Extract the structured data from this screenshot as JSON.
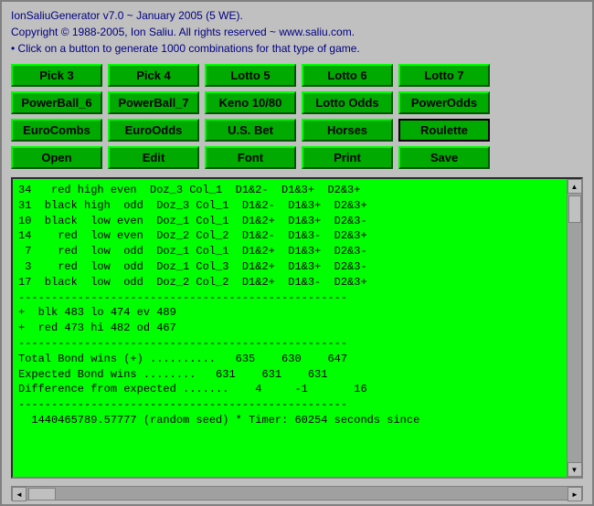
{
  "header": {
    "line1": "IonSaliuGenerator v7.0 ~ January 2005 (5 WE).",
    "line2": "Copyright © 1988-2005, Ion Saliu. All rights reserved ~ www.saliu.com.",
    "line3": "• Click on a button to generate 1000 combinations for that type of game."
  },
  "buttons": {
    "row1": [
      "Pick 3",
      "Pick 4",
      "Lotto 5",
      "Lotto 6",
      "Lotto 7"
    ],
    "row2": [
      "PowerBall_6",
      "PowerBall_7",
      "Keno 10/80",
      "Lotto Odds",
      "PowerOdds"
    ],
    "row3": [
      "EuroCombs",
      "EuroOdds",
      "U.S. Bet",
      "Horses",
      "Roulette"
    ],
    "row4": [
      "Open",
      "Edit",
      "Font",
      "Print",
      "Save"
    ]
  },
  "output": {
    "content": "34   red high even  Doz_3 Col_1  D1&2-  D1&3+  D2&3+\n31  black high  odd  Doz_3 Col_1  D1&2-  D1&3+  D2&3+\n10  black  low even  Doz_1 Col_1  D1&2+  D1&3+  D2&3-\n14    red  low even  Doz_2 Col_2  D1&2-  D1&3-  D2&3+\n 7    red  low  odd  Doz_1 Col_1  D1&2+  D1&3+  D2&3-\n 3    red  low  odd  Doz_1 Col_3  D1&2+  D1&3+  D2&3-\n17  black  low  odd  Doz_2 Col_2  D1&2+  D1&3-  D2&3+\n--------------------------------------------------\n+  blk 483 lo 474 ev 489\n+  red 473 hi 482 od 467\n--------------------------------------------------\nTotal Bond wins (+) ..........   635    630    647\nExpected Bond wins ........   631    631    631\nDifference from expected .......    4     -1       16\n--------------------------------------------------\n  1440465789.57777 (random seed) * Timer: 60254 seconds since"
  },
  "scrollbar": {
    "up_arrow": "▲",
    "down_arrow": "▼",
    "left_arrow": "◄",
    "right_arrow": "►"
  }
}
